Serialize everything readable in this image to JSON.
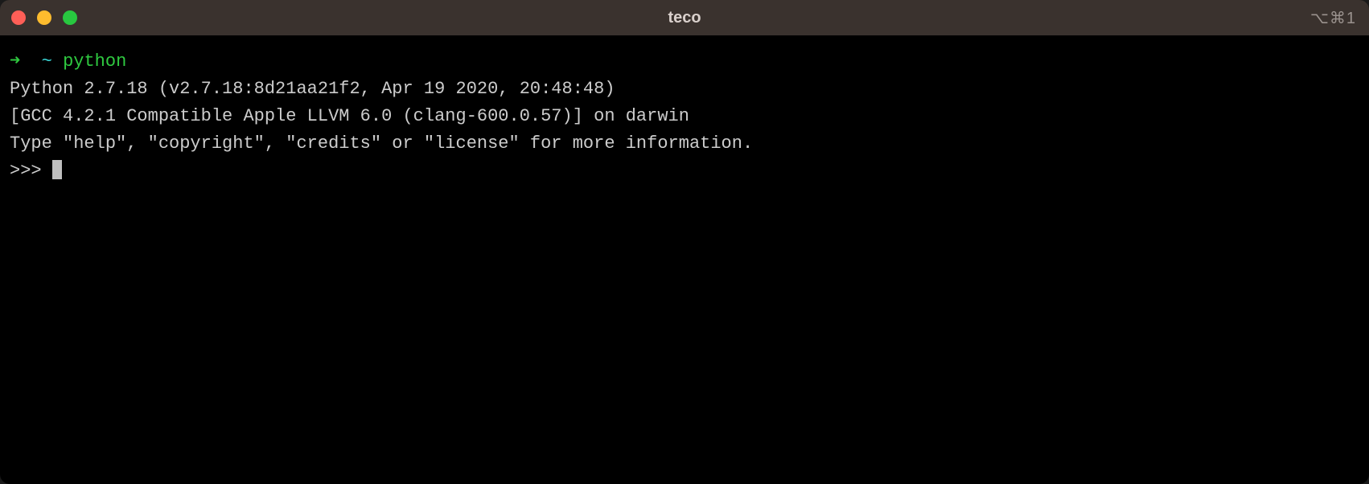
{
  "window": {
    "title": "teco",
    "pane_indicator": "⌥⌘1"
  },
  "shell": {
    "prompt_arrow": "➜",
    "prompt_path": "~",
    "command": "python"
  },
  "python": {
    "header_line1": "Python 2.7.18 (v2.7.18:8d21aa21f2, Apr 19 2020, 20:48:48)",
    "header_line2": "[GCC 4.2.1 Compatible Apple LLVM 6.0 (clang-600.0.57)] on darwin",
    "header_line3": "Type \"help\", \"copyright\", \"credits\" or \"license\" for more information.",
    "repl_prompt": ">>> "
  }
}
